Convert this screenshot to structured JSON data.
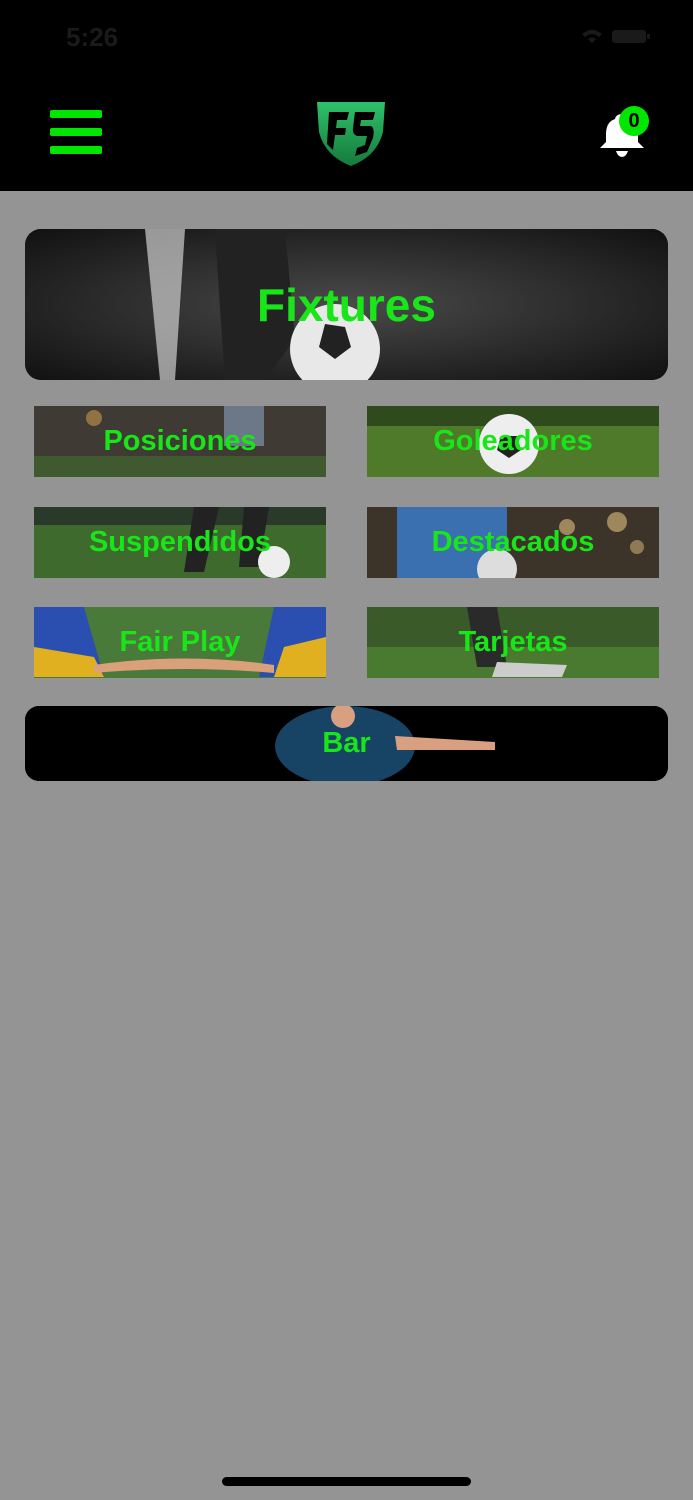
{
  "status_bar": {
    "time": "5:26"
  },
  "header": {
    "notifications_count": "0"
  },
  "main": {
    "fixtures_label": "Fixtures",
    "tiles": [
      {
        "label": "Posiciones"
      },
      {
        "label": "Goleadores"
      },
      {
        "label": "Suspendidos"
      },
      {
        "label": "Destacados"
      },
      {
        "label": "Fair Play"
      },
      {
        "label": "Tarjetas"
      }
    ],
    "bar_label": "Bar"
  },
  "colors": {
    "accent": "#19e619",
    "header_bg": "#000000",
    "page_bg": "#949494"
  }
}
